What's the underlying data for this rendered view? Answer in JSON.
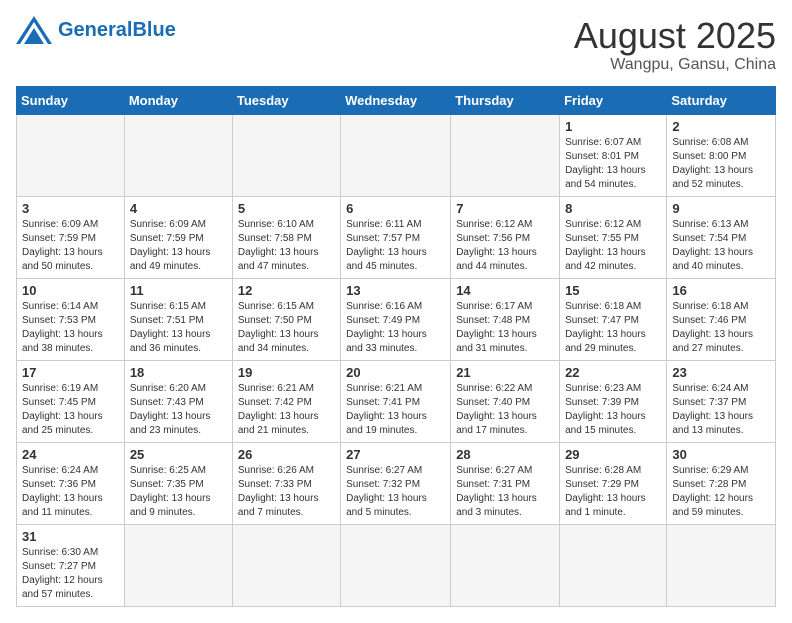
{
  "header": {
    "logo_general": "General",
    "logo_blue": "Blue",
    "month_title": "August 2025",
    "location": "Wangpu, Gansu, China"
  },
  "weekdays": [
    "Sunday",
    "Monday",
    "Tuesday",
    "Wednesday",
    "Thursday",
    "Friday",
    "Saturday"
  ],
  "weeks": [
    [
      {
        "day": "",
        "info": ""
      },
      {
        "day": "",
        "info": ""
      },
      {
        "day": "",
        "info": ""
      },
      {
        "day": "",
        "info": ""
      },
      {
        "day": "",
        "info": ""
      },
      {
        "day": "1",
        "info": "Sunrise: 6:07 AM\nSunset: 8:01 PM\nDaylight: 13 hours and 54 minutes."
      },
      {
        "day": "2",
        "info": "Sunrise: 6:08 AM\nSunset: 8:00 PM\nDaylight: 13 hours and 52 minutes."
      }
    ],
    [
      {
        "day": "3",
        "info": "Sunrise: 6:09 AM\nSunset: 7:59 PM\nDaylight: 13 hours and 50 minutes."
      },
      {
        "day": "4",
        "info": "Sunrise: 6:09 AM\nSunset: 7:59 PM\nDaylight: 13 hours and 49 minutes."
      },
      {
        "day": "5",
        "info": "Sunrise: 6:10 AM\nSunset: 7:58 PM\nDaylight: 13 hours and 47 minutes."
      },
      {
        "day": "6",
        "info": "Sunrise: 6:11 AM\nSunset: 7:57 PM\nDaylight: 13 hours and 45 minutes."
      },
      {
        "day": "7",
        "info": "Sunrise: 6:12 AM\nSunset: 7:56 PM\nDaylight: 13 hours and 44 minutes."
      },
      {
        "day": "8",
        "info": "Sunrise: 6:12 AM\nSunset: 7:55 PM\nDaylight: 13 hours and 42 minutes."
      },
      {
        "day": "9",
        "info": "Sunrise: 6:13 AM\nSunset: 7:54 PM\nDaylight: 13 hours and 40 minutes."
      }
    ],
    [
      {
        "day": "10",
        "info": "Sunrise: 6:14 AM\nSunset: 7:53 PM\nDaylight: 13 hours and 38 minutes."
      },
      {
        "day": "11",
        "info": "Sunrise: 6:15 AM\nSunset: 7:51 PM\nDaylight: 13 hours and 36 minutes."
      },
      {
        "day": "12",
        "info": "Sunrise: 6:15 AM\nSunset: 7:50 PM\nDaylight: 13 hours and 34 minutes."
      },
      {
        "day": "13",
        "info": "Sunrise: 6:16 AM\nSunset: 7:49 PM\nDaylight: 13 hours and 33 minutes."
      },
      {
        "day": "14",
        "info": "Sunrise: 6:17 AM\nSunset: 7:48 PM\nDaylight: 13 hours and 31 minutes."
      },
      {
        "day": "15",
        "info": "Sunrise: 6:18 AM\nSunset: 7:47 PM\nDaylight: 13 hours and 29 minutes."
      },
      {
        "day": "16",
        "info": "Sunrise: 6:18 AM\nSunset: 7:46 PM\nDaylight: 13 hours and 27 minutes."
      }
    ],
    [
      {
        "day": "17",
        "info": "Sunrise: 6:19 AM\nSunset: 7:45 PM\nDaylight: 13 hours and 25 minutes."
      },
      {
        "day": "18",
        "info": "Sunrise: 6:20 AM\nSunset: 7:43 PM\nDaylight: 13 hours and 23 minutes."
      },
      {
        "day": "19",
        "info": "Sunrise: 6:21 AM\nSunset: 7:42 PM\nDaylight: 13 hours and 21 minutes."
      },
      {
        "day": "20",
        "info": "Sunrise: 6:21 AM\nSunset: 7:41 PM\nDaylight: 13 hours and 19 minutes."
      },
      {
        "day": "21",
        "info": "Sunrise: 6:22 AM\nSunset: 7:40 PM\nDaylight: 13 hours and 17 minutes."
      },
      {
        "day": "22",
        "info": "Sunrise: 6:23 AM\nSunset: 7:39 PM\nDaylight: 13 hours and 15 minutes."
      },
      {
        "day": "23",
        "info": "Sunrise: 6:24 AM\nSunset: 7:37 PM\nDaylight: 13 hours and 13 minutes."
      }
    ],
    [
      {
        "day": "24",
        "info": "Sunrise: 6:24 AM\nSunset: 7:36 PM\nDaylight: 13 hours and 11 minutes."
      },
      {
        "day": "25",
        "info": "Sunrise: 6:25 AM\nSunset: 7:35 PM\nDaylight: 13 hours and 9 minutes."
      },
      {
        "day": "26",
        "info": "Sunrise: 6:26 AM\nSunset: 7:33 PM\nDaylight: 13 hours and 7 minutes."
      },
      {
        "day": "27",
        "info": "Sunrise: 6:27 AM\nSunset: 7:32 PM\nDaylight: 13 hours and 5 minutes."
      },
      {
        "day": "28",
        "info": "Sunrise: 6:27 AM\nSunset: 7:31 PM\nDaylight: 13 hours and 3 minutes."
      },
      {
        "day": "29",
        "info": "Sunrise: 6:28 AM\nSunset: 7:29 PM\nDaylight: 13 hours and 1 minute."
      },
      {
        "day": "30",
        "info": "Sunrise: 6:29 AM\nSunset: 7:28 PM\nDaylight: 12 hours and 59 minutes."
      }
    ],
    [
      {
        "day": "31",
        "info": "Sunrise: 6:30 AM\nSunset: 7:27 PM\nDaylight: 12 hours and 57 minutes."
      },
      {
        "day": "",
        "info": ""
      },
      {
        "day": "",
        "info": ""
      },
      {
        "day": "",
        "info": ""
      },
      {
        "day": "",
        "info": ""
      },
      {
        "day": "",
        "info": ""
      },
      {
        "day": "",
        "info": ""
      }
    ]
  ]
}
